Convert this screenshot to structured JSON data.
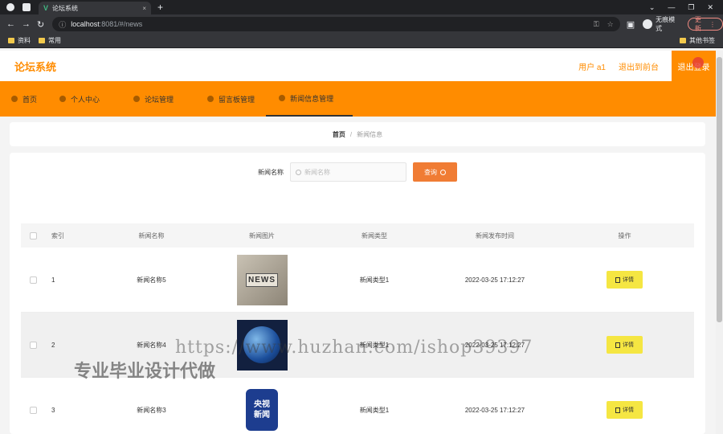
{
  "browser": {
    "tab_title": "论坛系统",
    "url_host": "localhost",
    "url_rest": ":8081/#/news",
    "incognito_label": "无痕模式",
    "update_label": "更新",
    "bookmarks": [
      "资料",
      "常用"
    ],
    "other_bookmarks": "其他书签"
  },
  "header": {
    "app_title": "论坛系统",
    "user_label": "用户 a1",
    "back_label": "退出到前台",
    "logout_label": "退出登录"
  },
  "menu": [
    {
      "label": "首页",
      "active": false
    },
    {
      "label": "个人中心",
      "active": false
    },
    {
      "label": "论坛管理",
      "active": false
    },
    {
      "label": "留言板管理",
      "active": false
    },
    {
      "label": "新闻信息管理",
      "active": true
    }
  ],
  "breadcrumb": {
    "home": "首页",
    "separator": "/",
    "current": "新闻信息"
  },
  "search": {
    "label": "新闻名称",
    "placeholder": "新闻名称",
    "button": "查询"
  },
  "table": {
    "columns": [
      "索引",
      "新闻名称",
      "新闻图片",
      "新闻类型",
      "新闻发布时间",
      "操作"
    ],
    "rows": [
      {
        "index": "1",
        "name": "新闻名称5",
        "image": "news",
        "type": "新闻类型1",
        "time": "2022-03-25 17:12:27",
        "action": "详情"
      },
      {
        "index": "2",
        "name": "新闻名称4",
        "image": "globe",
        "type": "新闻类型1",
        "time": "2022-03-25 17:12:27",
        "action": "详情"
      },
      {
        "index": "3",
        "name": "新闻名称3",
        "image": "cctv",
        "type": "新闻类型1",
        "time": "2022-03-25 17:12:27",
        "action": "详情"
      }
    ],
    "img_news_text": "NEWS",
    "img_cctv_text_1": "央视",
    "img_cctv_text_2": "新闻"
  },
  "watermark": {
    "url": "https://www.huzhan.com/ishop39397",
    "text": "专业毕业设计代做"
  },
  "colors": {
    "accent": "#ff8c00",
    "button_search": "#f07c34",
    "button_detail": "#f5e642"
  }
}
